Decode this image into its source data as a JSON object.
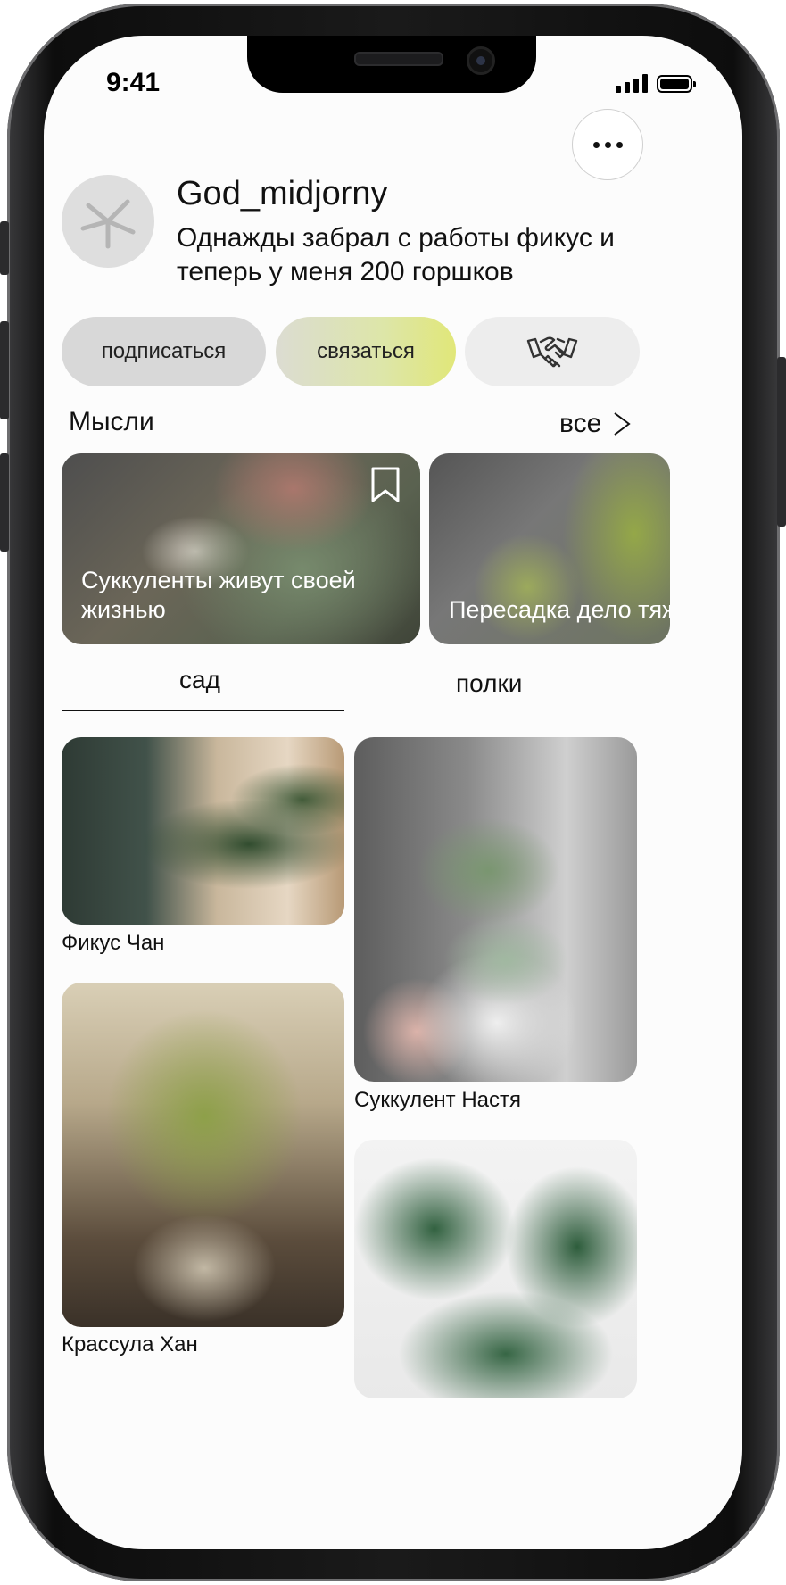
{
  "status_bar": {
    "time": "9:41"
  },
  "profile": {
    "username": "God_midjorny",
    "bio": "Однажды забрал с работы фикус и теперь у меня 200 горшков"
  },
  "actions": {
    "subscribe_label": "подписаться",
    "contact_label": "связаться",
    "deal_icon": "handshake-icon"
  },
  "thoughts": {
    "title": "Мысли",
    "all_label": "все",
    "cards": [
      {
        "text": "Суккуленты живут своей жизнью",
        "bookmarked": false
      },
      {
        "text": "Пересадка дело тяжелое"
      }
    ]
  },
  "tabs": [
    {
      "label": "сад",
      "active": true
    },
    {
      "label": "полки",
      "active": false
    }
  ],
  "plants": [
    {
      "name": "Фикус Чан"
    },
    {
      "name": "Суккулент Настя"
    },
    {
      "name": "Крассула Хан"
    },
    {
      "name": ""
    }
  ],
  "colors": {
    "contact_accent": "#e1e779",
    "subscribe_bg": "#d8d8d8",
    "text": "#111111"
  }
}
